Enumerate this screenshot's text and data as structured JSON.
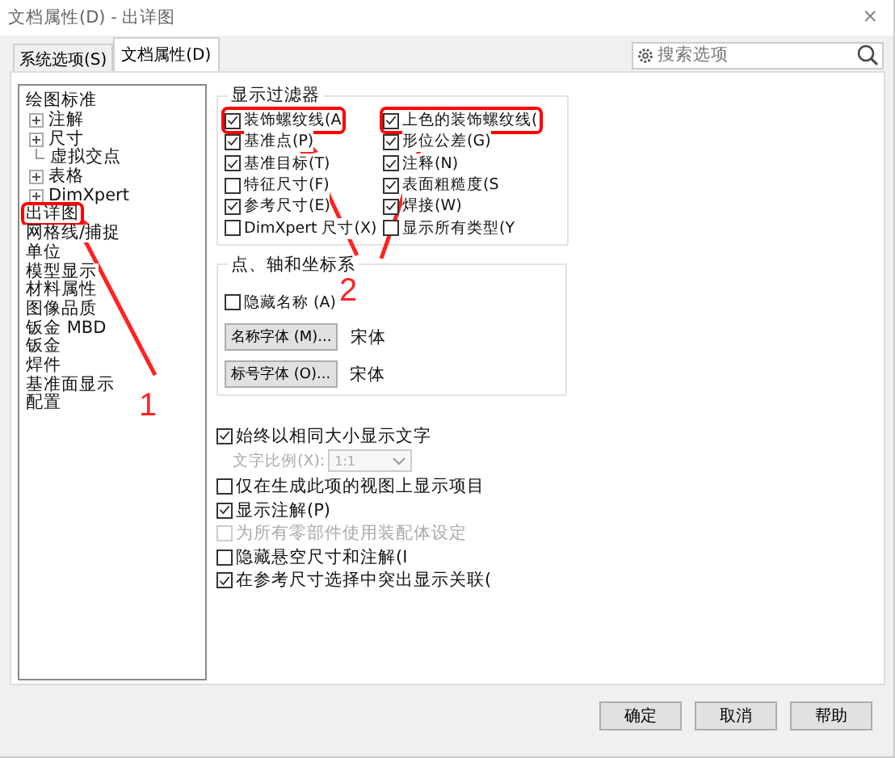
{
  "window": {
    "title": "文档属性(D) - 出详图",
    "close": "×"
  },
  "tabs": [
    {
      "label": "系统选项(S)",
      "selected": false
    },
    {
      "label": "文档属性(D)",
      "selected": true
    }
  ],
  "search": {
    "placeholder": "搜索选项"
  },
  "tree": [
    {
      "label": "绘图标准",
      "kind": "plain",
      "annotated": false
    },
    {
      "label": "注解",
      "kind": "node",
      "expanded": false,
      "annotated": false
    },
    {
      "label": "尺寸",
      "kind": "node",
      "expanded": false,
      "annotated": false
    },
    {
      "label": "虚拟交点",
      "kind": "leaf",
      "annotated": false
    },
    {
      "label": "表格",
      "kind": "node",
      "expanded": false,
      "annotated": false
    },
    {
      "label": "DimXpert",
      "kind": "node",
      "expanded": false,
      "annotated": false
    },
    {
      "label": "出详图",
      "kind": "plain",
      "annotated": true
    },
    {
      "label": "网格线/捕捉",
      "kind": "plain",
      "annotated": false
    },
    {
      "label": "单位",
      "kind": "plain",
      "annotated": false
    },
    {
      "label": "模型显示",
      "kind": "plain",
      "annotated": false
    },
    {
      "label": "材料属性",
      "kind": "plain",
      "annotated": false
    },
    {
      "label": "图像品质",
      "kind": "plain",
      "annotated": false
    },
    {
      "label": "钣金 MBD",
      "kind": "plain",
      "annotated": false
    },
    {
      "label": "钣金",
      "kind": "plain",
      "annotated": false
    },
    {
      "label": "焊件",
      "kind": "plain",
      "annotated": false
    },
    {
      "label": "基准面显示",
      "kind": "plain",
      "annotated": false
    },
    {
      "label": "配置",
      "kind": "plain",
      "annotated": false
    }
  ],
  "filter": {
    "title": "显示过滤器",
    "columns": [
      [
        {
          "label": "装饰螺纹线(A",
          "checked": true,
          "annotated": true
        },
        {
          "label": "基准点(P)",
          "checked": true,
          "annotated": false
        },
        {
          "label": "基准目标(T)",
          "checked": true,
          "annotated": false
        },
        {
          "label": "特征尺寸(F)",
          "checked": false,
          "annotated": false
        },
        {
          "label": "参考尺寸(E)",
          "checked": true,
          "annotated": false
        },
        {
          "label": "DimXpert 尺寸(X)",
          "checked": false,
          "annotated": false
        }
      ],
      [
        {
          "label": "上色的装饰螺纹线(",
          "checked": true,
          "annotated": true
        },
        {
          "label": "形位公差(G)",
          "checked": true,
          "annotated": false
        },
        {
          "label": "注释(N)",
          "checked": true,
          "annotated": false
        },
        {
          "label": "表面粗糙度(S",
          "checked": true,
          "annotated": false
        },
        {
          "label": "焊接(W)",
          "checked": true,
          "annotated": false
        },
        {
          "label": "显示所有类型(Y",
          "checked": false,
          "annotated": false
        }
      ]
    ]
  },
  "axes": {
    "title": "点、轴和坐标系",
    "hide_names": {
      "label": "隐藏名称 (A)",
      "checked": false
    },
    "fonts": [
      {
        "button": "名称字体 (M)...",
        "value": "宋体"
      },
      {
        "button": "标号字体 (O)...",
        "value": "宋体"
      }
    ]
  },
  "options": [
    {
      "kind": "checkbox",
      "label": "始终以相同大小显示文字",
      "checked": true,
      "disabled": false
    },
    {
      "kind": "dropdown",
      "label": "文字比例(X):",
      "value": "1:1",
      "disabled": true
    },
    {
      "kind": "checkbox",
      "label": "仅在生成此项的视图上显示项目",
      "checked": false,
      "disabled": false
    },
    {
      "kind": "checkbox",
      "label": "显示注解(P)",
      "checked": true,
      "disabled": false
    },
    {
      "kind": "checkbox",
      "label": "为所有零部件使用装配体设定",
      "checked": false,
      "disabled": true
    },
    {
      "kind": "checkbox",
      "label": "隐藏悬空尺寸和注解(I",
      "checked": false,
      "disabled": false
    },
    {
      "kind": "checkbox",
      "label": "在参考尺寸选择中突出显示关联(",
      "checked": true,
      "disabled": false
    }
  ],
  "buttons": [
    "确定",
    "取消",
    "帮助"
  ],
  "annotation_labels": [
    "1",
    "2"
  ]
}
